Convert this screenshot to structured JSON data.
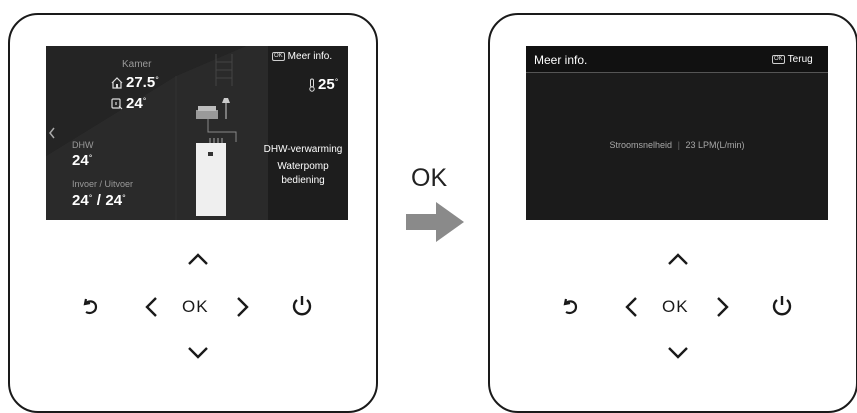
{
  "left_screen": {
    "room_label": "Kamer",
    "room_temp": "27.5",
    "room_setpoint": "24",
    "more_info_chip": "OK",
    "more_info_label": "Meer info.",
    "outdoor_temp": "25",
    "dhw_label": "DHW",
    "dhw_temp": "24",
    "flow_label": "Invoer / Uitvoer",
    "flow_in": "24",
    "flow_out": "24",
    "status_line1": "DHW-verwarming",
    "status_line2": "Waterpomp",
    "status_line3": "bediening",
    "degree": "°",
    "slash": "/"
  },
  "right_screen": {
    "title": "Meer info.",
    "back_chip": "OK",
    "back_label": "Terug",
    "flow_rate_label": "Stroomsnelheid",
    "separator": "|",
    "flow_rate_value": "23 LPM(L/min)"
  },
  "buttons": {
    "ok_label": "OK"
  },
  "transition": {
    "label": "OK",
    "arrow_color": "#8a8a8a"
  },
  "icons": [
    "home-icon",
    "setpoint-icon",
    "thermometer-icon",
    "chevron-left-icon",
    "chevron-up-icon",
    "chevron-down-icon",
    "chevron-right-icon",
    "back-icon",
    "power-icon",
    "arrow-right-icon"
  ]
}
